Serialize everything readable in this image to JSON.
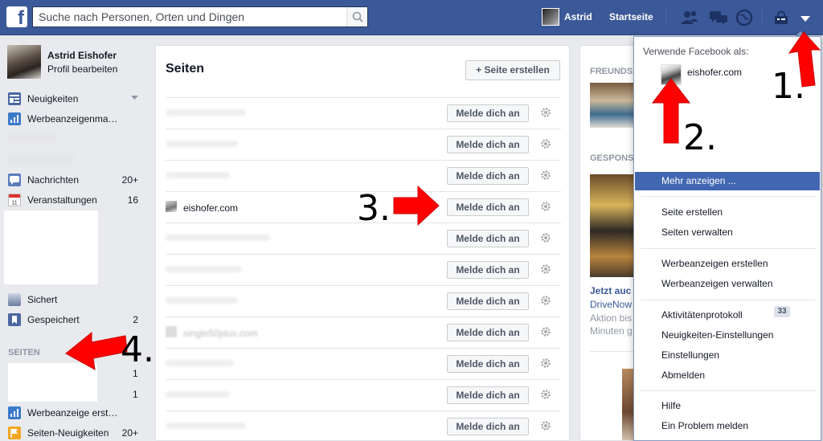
{
  "topbar": {
    "logo_letter": "f",
    "search_placeholder": "Suche nach Personen, Orten und Dingen",
    "user_name": "Astrid",
    "home_label": "Startseite"
  },
  "profile": {
    "name": "Astrid Eishofer",
    "edit_label": "Profil bearbeiten"
  },
  "left_nav": [
    {
      "label": "Neuigkeiten",
      "count": ""
    },
    {
      "label": "Werbeanzeigenma…",
      "count": ""
    },
    {
      "label": "Nachrichten",
      "count": "20+"
    },
    {
      "label": "Veranstaltungen",
      "count": "16"
    },
    {
      "label": "Sichert",
      "count": ""
    },
    {
      "label": "Gespeichert",
      "count": "2"
    }
  ],
  "left_pages": {
    "section_title": "SEITEN",
    "counts": [
      "1",
      "1"
    ],
    "items": [
      {
        "label": "Werbeanzeige erst…",
        "count": ""
      },
      {
        "label": "Seiten-Neuigkeiten",
        "count": "20+"
      }
    ]
  },
  "main": {
    "title": "Seiten",
    "create_button": "+ Seite erstellen",
    "login_button": "Melde dich an",
    "visible_page_name": "eishofer.com",
    "blurred_page_name": "single50plus.com"
  },
  "right_col": {
    "friends_header": "FREUNDS",
    "sponsored_header": "GESPONS",
    "ad_title": "Jetzt auc",
    "ad_brand": "DriveNow",
    "ad_text1": "Aktion bis",
    "ad_text2": "Minuten g"
  },
  "dropdown": {
    "use_as": "Verwende Facebook als:",
    "account_name": "eishofer.com",
    "more": "Mehr anzeigen ...",
    "group1": [
      "Seite erstellen",
      "Seiten verwalten"
    ],
    "group2": [
      "Werbeanzeigen erstellen",
      "Werbeanzeigen verwalten"
    ],
    "group3": [
      "Aktivitätenprotokoll",
      "Neuigkeiten-Einstellungen",
      "Einstellungen",
      "Abmelden"
    ],
    "activity_badge": "33",
    "group4": [
      "Hilfe",
      "Ein Problem melden"
    ]
  },
  "annotations": [
    "1.",
    "2.",
    "3.",
    "4."
  ],
  "colors": {
    "facebook_blue": "#3b5998",
    "highlight_blue": "#4267b2",
    "arrow_red": "#ff0000"
  }
}
